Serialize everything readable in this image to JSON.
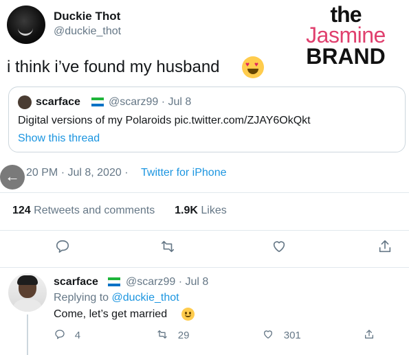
{
  "author": {
    "display_name": "Duckie Thot",
    "handle": "@duckie_thot"
  },
  "logo": {
    "line1": "the",
    "line2": "Jasmine",
    "line3": "BRAND",
    "accent_color": "#e0406e"
  },
  "tweet": {
    "text": "i think i’ve found my husband",
    "emoji": "heart-eyes-emoji"
  },
  "quoted_tweet": {
    "name": "scarface",
    "handle_date": "@scarz99 · Jul 8",
    "text": "Digital versions of my Polaroids pic.twitter.com/ZJAY6OkQkt",
    "show_thread": "Show this thread"
  },
  "meta": {
    "timestamp": "20 PM · Jul 8, 2020 · ",
    "source": "Twitter for iPhone"
  },
  "stats": {
    "retweets_count": "124",
    "retweets_label": " Retweets and comments",
    "likes_count": "1.9K",
    "likes_label": " Likes"
  },
  "actions": {
    "reply_icon": "comment-icon",
    "retweet_icon": "retweet-icon",
    "like_icon": "heart-icon",
    "share_icon": "share-icon"
  },
  "reply": {
    "name": "scarface",
    "handle_date": "@scarz99 · Jul 8",
    "replying_prefix": "Replying to ",
    "replying_handle": "@duckie_thot",
    "text": "Come, let’s get married",
    "reply_count": "4",
    "retweet_count": "29",
    "like_count": "301"
  },
  "colors": {
    "link": "#1b95e0",
    "muted": "#657786",
    "flag_green": "#1eb53a",
    "flag_white": "#ffffff",
    "flag_blue": "#0072c6"
  }
}
